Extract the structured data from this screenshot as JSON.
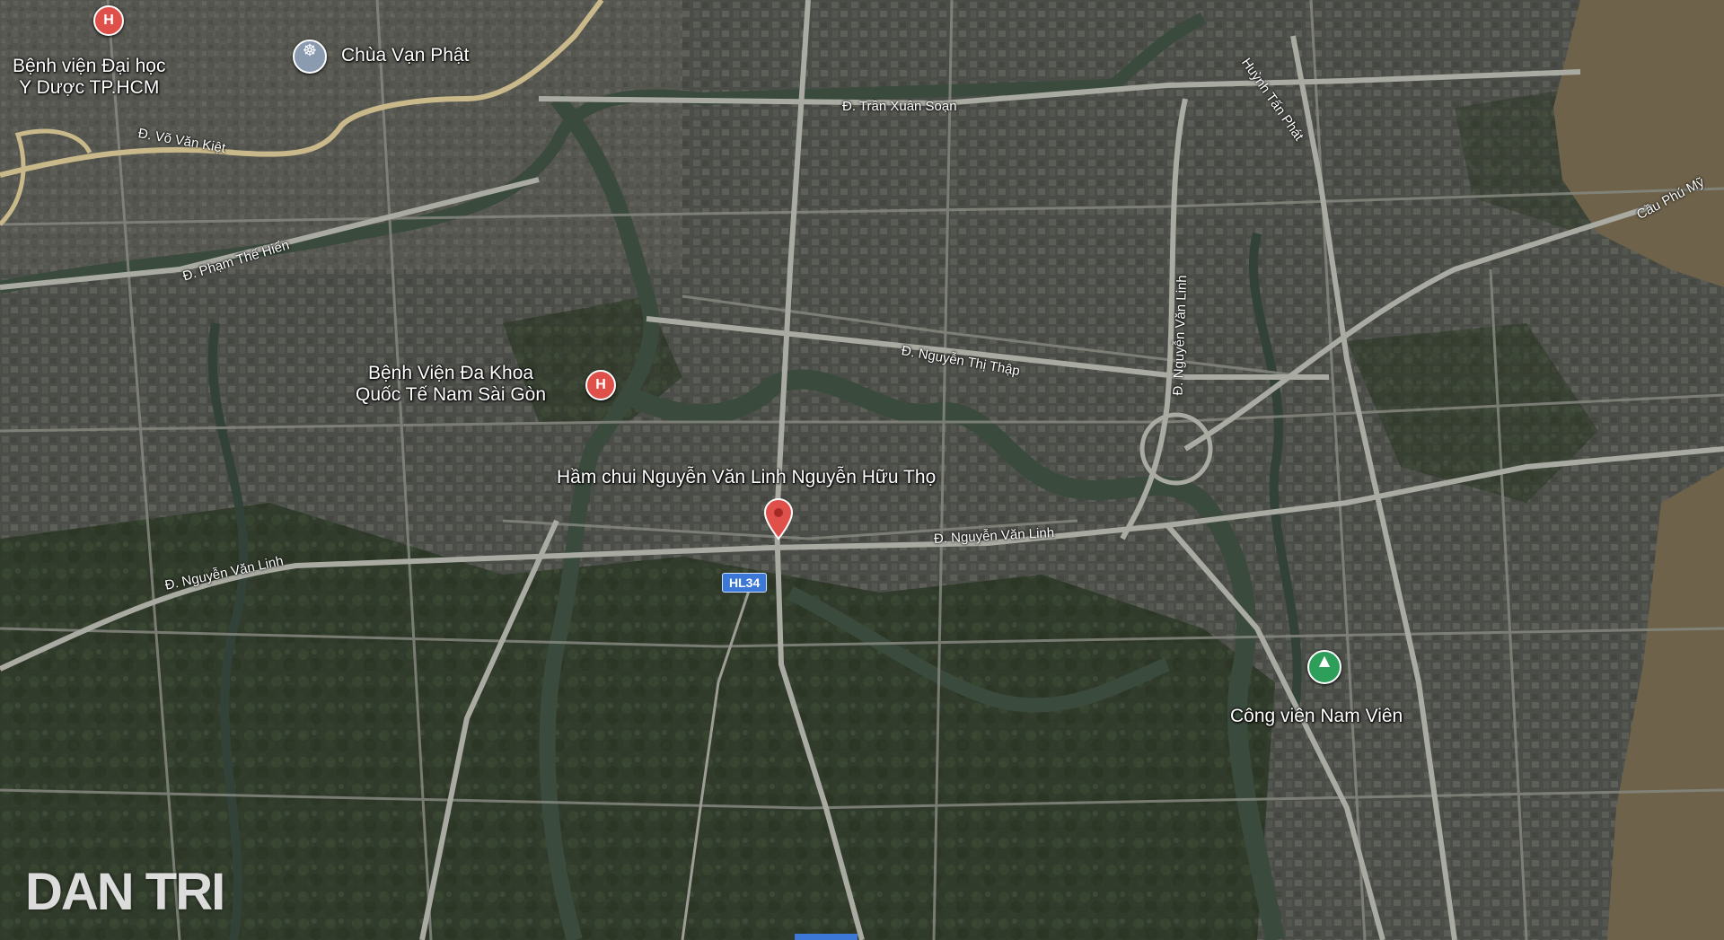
{
  "map": {
    "colors": {
      "urban": "#4a4c48",
      "dense_urban": "#55574f",
      "vegetation": "#2d3a26",
      "water": "#3a4a3c",
      "river_main": "#6b5f48",
      "road": "#8a8c86",
      "highway": "#c9b98a",
      "red_pin": "#e0504a",
      "green_pin": "#2e9e5b",
      "poi_blue_gray": "#8a9bb0",
      "shield_blue": "#3b78d8"
    },
    "pois": {
      "hospital_1": "Bệnh viện Đại học\nY Dược TP.HCM",
      "pagoda": "Chùa Vạn Phật",
      "hospital_2": "Bệnh Viện Đa Khoa\nQuốc Tế Nam Sài Gòn",
      "tunnel": "Hầm chui Nguyễn Văn Linh Nguyễn Hữu Thọ",
      "park": "Công viên Nam Viên"
    },
    "roads": {
      "vo_van_kiet": "Đ. Võ Văn Kiệt",
      "tran_xuan_soan": "Đ. Trần Xuân Soạn",
      "huynh_tan_phat": "Huỳnh Tấn Phát",
      "cau_phu_my": "Cầu Phú Mỹ",
      "pham_the_hien": "Đ. Phạm Thế Hiển",
      "nguyen_thi_thap": "Đ. Nguyễn Thị Thập",
      "nguyen_van_linh_vertical": "Đ. Nguyễn Văn Linh",
      "nguyen_van_linh_east": "Đ. Nguyễn Văn Linh",
      "nguyen_van_linh_west": "Đ. Nguyễn Văn Linh"
    },
    "shield": "HL34",
    "icons": {
      "hospital": "hospital-icon",
      "pagoda": "dharma-wheel-icon",
      "park": "tree-icon",
      "pin": "location-pin-icon"
    },
    "pin_glyphs": {
      "hospital": "H",
      "pagoda": "☸",
      "park": "▲"
    },
    "watermark": "DAN TRI"
  }
}
